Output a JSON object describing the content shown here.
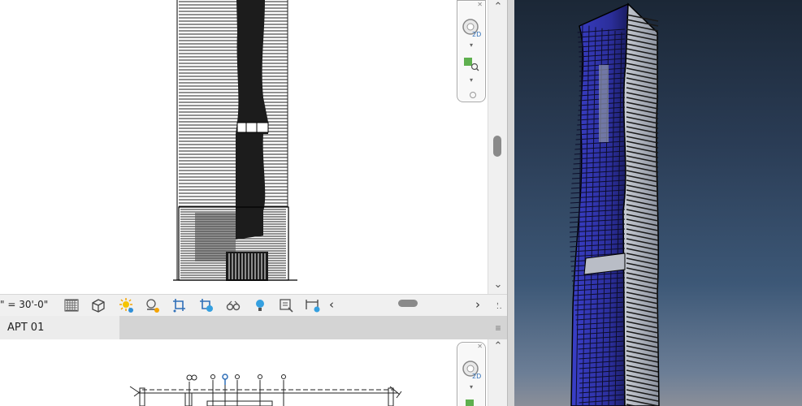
{
  "view_control": {
    "scale": "\" = 30'-0\"",
    "icons": [
      "detail-level-icon",
      "visual-style-icon",
      "sun-path-icon",
      "shadows-icon",
      "crop-view-icon",
      "show-crop-region-icon",
      "temporary-hide-icon",
      "reveal-hidden-icon",
      "analytical-model-icon",
      "highlight-displacement-icon"
    ]
  },
  "lower_view": {
    "tab_title": "APT 01"
  },
  "navigation_bar": {
    "wheel_badge": "2D"
  },
  "colors": {
    "sky_top": "#1b2736",
    "sky_bottom": "#8b8f99",
    "glass": "#3b3fd0",
    "ui_bg": "#f0f0f0"
  }
}
